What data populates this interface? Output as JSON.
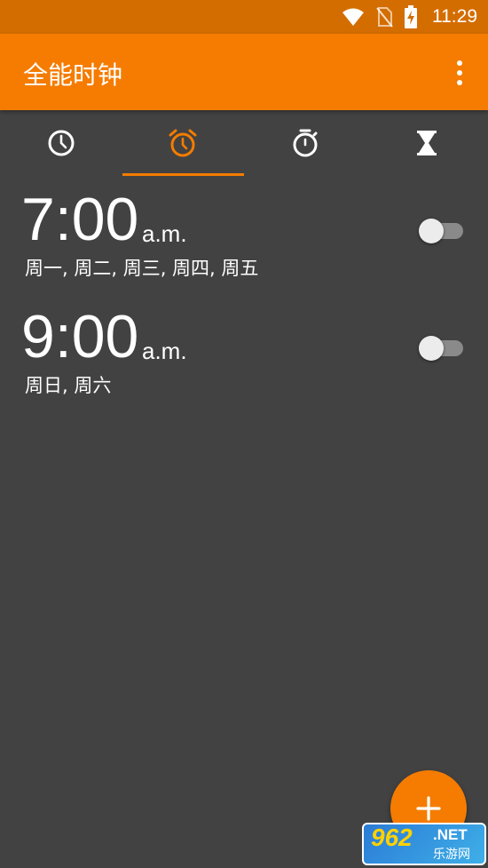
{
  "status_bar": {
    "time": "11:29",
    "icons": [
      "wifi-icon",
      "no-sim-icon",
      "battery-charging-icon"
    ]
  },
  "app_bar": {
    "title": "全能时钟",
    "menu_icon": "more-vert-icon"
  },
  "tabs": [
    {
      "icon": "clock-icon",
      "active": false
    },
    {
      "icon": "alarm-icon",
      "active": true
    },
    {
      "icon": "stopwatch-icon",
      "active": false
    },
    {
      "icon": "hourglass-icon",
      "active": false
    }
  ],
  "alarms": [
    {
      "time": "7:00",
      "ampm": "a.m.",
      "days": "周一, 周二, 周三, 周四, 周五",
      "enabled": false
    },
    {
      "time": "9:00",
      "ampm": "a.m.",
      "days": "周日, 周六",
      "enabled": false
    }
  ],
  "fab": {
    "icon": "plus-icon"
  },
  "watermark": {
    "number": "962",
    "suffix": ".NET",
    "sub": "乐游网"
  },
  "colors": {
    "accent": "#f57c00",
    "status_bar": "#d46d00",
    "background": "#424242",
    "icon_inactive": "#ffffff"
  }
}
